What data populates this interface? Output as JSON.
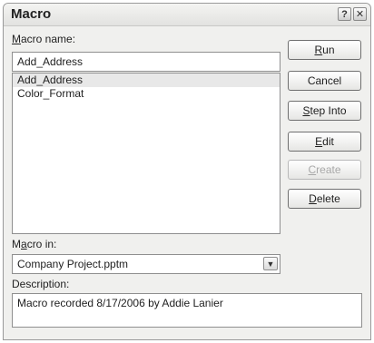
{
  "window": {
    "title": "Macro",
    "help_glyph": "?",
    "close_glyph": "✕"
  },
  "macro_name": {
    "label_accel": "M",
    "label_rest": "acro name:",
    "value": "Add_Address"
  },
  "macro_list": {
    "items": [
      {
        "name": "Add_Address",
        "selected": true
      },
      {
        "name": "Color_Format",
        "selected": false
      }
    ]
  },
  "buttons": {
    "run": {
      "accel": "R",
      "rest": "un"
    },
    "cancel": {
      "label": "Cancel"
    },
    "step_into": {
      "accel": "S",
      "rest": "tep Into"
    },
    "edit": {
      "accel": "E",
      "rest": "dit"
    },
    "create": {
      "accel": "C",
      "rest": "reate",
      "disabled": true
    },
    "delete": {
      "accel": "D",
      "rest": "elete"
    }
  },
  "macro_in": {
    "label_pre": "M",
    "label_accel": "a",
    "label_rest": "cro in:",
    "selected_value": "Company Project.pptm",
    "arrow_icon": "chevron-down"
  },
  "description": {
    "label": "Description:",
    "text": "Macro recorded 8/17/2006 by Addie Lanier"
  }
}
